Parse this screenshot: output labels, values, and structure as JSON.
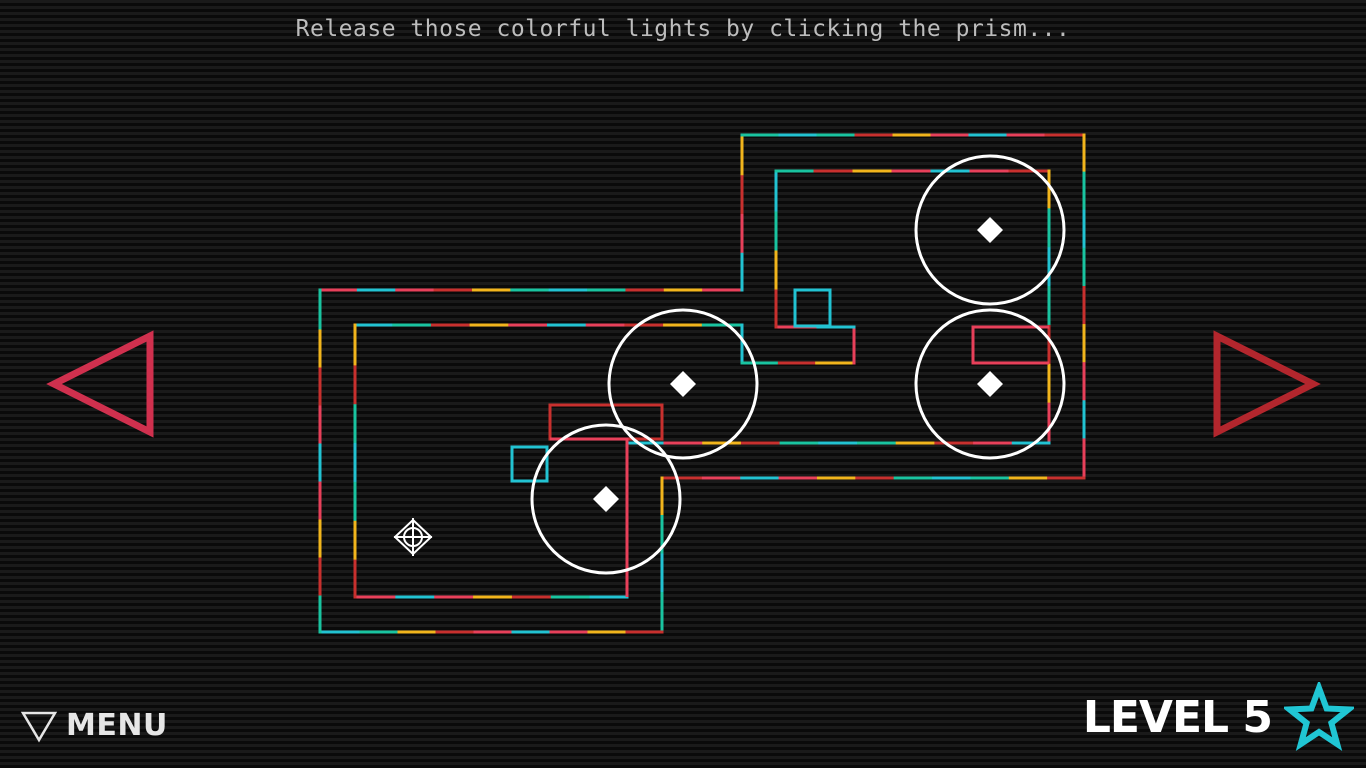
{
  "hint": {
    "text": "Release those colorful lights by clicking the prism..."
  },
  "menu": {
    "label": "MENU",
    "icon": "triangle-down-icon"
  },
  "level": {
    "label": "LEVEL 5",
    "star_icon": "star-outline-icon"
  },
  "navigation": {
    "prev_icon": "triangle-left-icon",
    "next_icon": "triangle-right-icon",
    "prev_color": "#d0304e",
    "next_color": "#b3262d"
  },
  "colors": {
    "red": "#e8405a",
    "dark_red": "#c8302e",
    "teal": "#19c4a0",
    "cyan": "#22c3d2",
    "yellow": "#f2b51c",
    "white": "#ffffff",
    "star": "#20c6d4",
    "background": "#0a0a0a"
  },
  "board": {
    "rotators": 4,
    "prism": "prism-crosshair-icon"
  }
}
